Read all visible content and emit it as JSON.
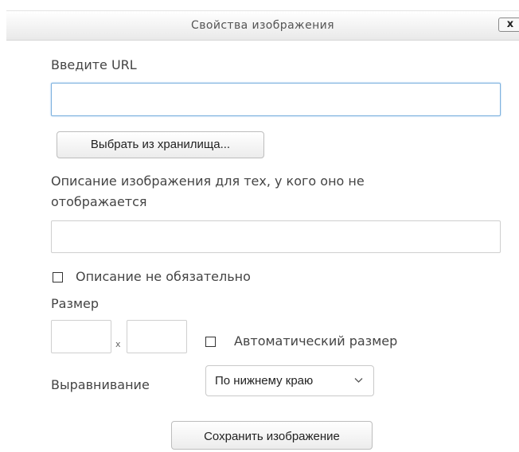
{
  "dialog": {
    "title": "Свойства изображения",
    "close_label": "x"
  },
  "url": {
    "label": "Введите URL",
    "value": ""
  },
  "browse_button": "Выбрать из хранилища...",
  "description": {
    "label_line1": "Описание изображения для тех, у кого оно не",
    "label_line2": "отображается",
    "value": ""
  },
  "description_optional": {
    "label": "Описание не обязательно",
    "checked": false
  },
  "size": {
    "label": "Размер",
    "width": "",
    "height": "",
    "separator": "x",
    "auto_label": "Автоматический размер",
    "auto_checked": false
  },
  "alignment": {
    "label": "Выравнивание",
    "selected": "По нижнему краю"
  },
  "save_button": "Сохранить изображение",
  "icons": {
    "close": "close-icon",
    "chevron": "chevron-down-icon"
  }
}
